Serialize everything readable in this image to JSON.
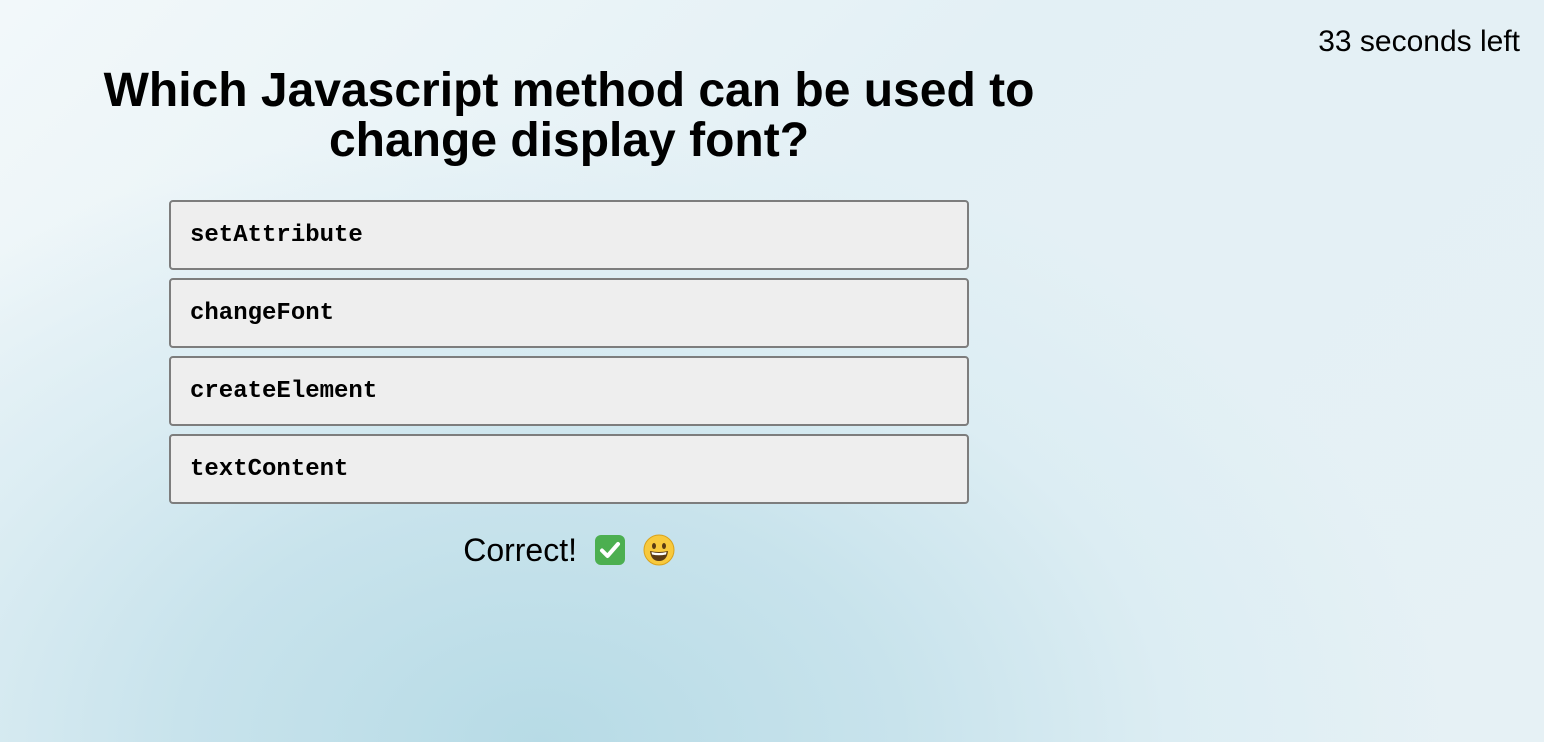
{
  "timer": {
    "text": "33 seconds left"
  },
  "question": {
    "text": "Which Javascript method can be used to change display font?"
  },
  "answers": [
    {
      "label": "setAttribute"
    },
    {
      "label": "changeFont"
    },
    {
      "label": "createElement"
    },
    {
      "label": "textContent"
    }
  ],
  "feedback": {
    "text": "Correct!",
    "icons": [
      "check-mark-icon",
      "grinning-face-icon"
    ],
    "colors": {
      "check_green": "#4caf50"
    }
  }
}
